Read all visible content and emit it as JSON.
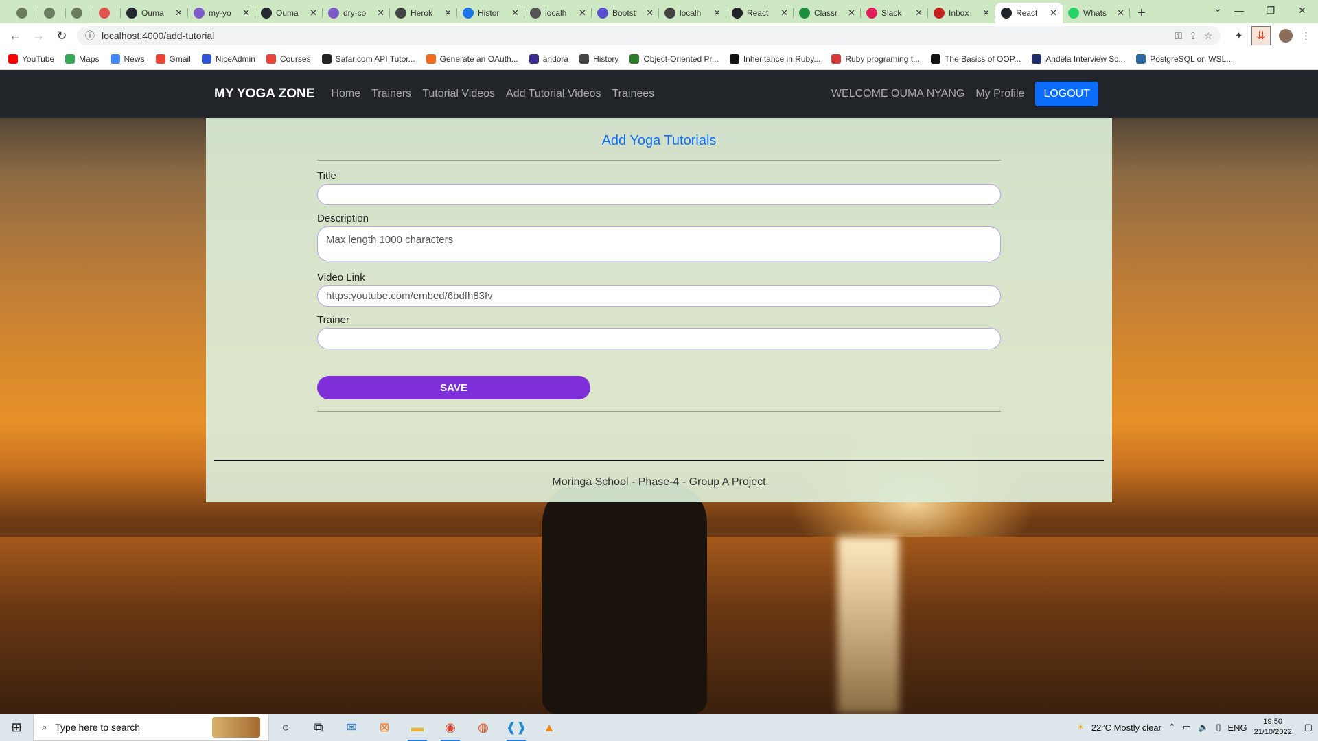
{
  "browser": {
    "tabs": [
      {
        "title": "",
        "fav_color": "#6b7d5e",
        "icon": "hamster-icon",
        "small": true
      },
      {
        "title": "",
        "fav_color": "#6b7d5e",
        "icon": "doc-icon",
        "small": true
      },
      {
        "title": "",
        "fav_color": "#6b7d5e",
        "icon": "hamster-icon",
        "small": true
      },
      {
        "title": "",
        "fav_color": "#e0524a",
        "icon": "ring-icon",
        "small": true
      },
      {
        "title": "Ouma",
        "fav_color": "#24292f",
        "icon": "github-icon"
      },
      {
        "title": "my-yo",
        "fav_color": "#7d5cc9",
        "icon": "heroku-icon"
      },
      {
        "title": "Ouma",
        "fav_color": "#24292f",
        "icon": "github-icon"
      },
      {
        "title": "dry-co",
        "fav_color": "#7d5cc9",
        "icon": "heroku-icon"
      },
      {
        "title": "Herok",
        "fav_color": "#444444",
        "icon": "globe-icon"
      },
      {
        "title": "Histor",
        "fav_color": "#1a73e8",
        "icon": "history-icon"
      },
      {
        "title": "localh",
        "fav_color": "#555555",
        "icon": "react-icon"
      },
      {
        "title": "Bootst",
        "fav_color": "#5a4fcf",
        "icon": "bootstrap-icon"
      },
      {
        "title": "localh",
        "fav_color": "#444444",
        "icon": "globe-icon"
      },
      {
        "title": "React",
        "fav_color": "#20232a",
        "icon": "react-icon"
      },
      {
        "title": "Classr",
        "fav_color": "#1e8e3e",
        "icon": "drive-icon"
      },
      {
        "title": "Slack",
        "fav_color": "#e01e5a",
        "icon": "slack-icon"
      },
      {
        "title": "Inbox",
        "fav_color": "#c5221f",
        "icon": "gmail-icon"
      },
      {
        "title": "React",
        "fav_color": "#20232a",
        "icon": "react-icon",
        "active": true
      },
      {
        "title": "Whats",
        "fav_color": "#25d366",
        "icon": "whatsapp-icon"
      }
    ],
    "url": "localhost:4000/add-tutorial",
    "bookmarks": [
      {
        "label": "YouTube",
        "color": "#ff0000"
      },
      {
        "label": "Maps",
        "color": "#34a853"
      },
      {
        "label": "News",
        "color": "#4285f4"
      },
      {
        "label": "Gmail",
        "color": "#ea4335"
      },
      {
        "label": "NiceAdmin",
        "color": "#2f55d4"
      },
      {
        "label": "Courses",
        "color": "#e8453c"
      },
      {
        "label": "Safaricom API Tutor...",
        "color": "#222222"
      },
      {
        "label": "Generate an OAuth...",
        "color": "#f26b1d"
      },
      {
        "label": "andora",
        "color": "#3b2d8f"
      },
      {
        "label": "History",
        "color": "#444444"
      },
      {
        "label": "Object-Oriented Pr...",
        "color": "#2a7a2a"
      },
      {
        "label": "Inheritance in Ruby...",
        "color": "#111111"
      },
      {
        "label": "Ruby programing t...",
        "color": "#d23c3c"
      },
      {
        "label": "The Basics of OOP...",
        "color": "#111111"
      },
      {
        "label": "Andela Interview Sc...",
        "color": "#1f2d6b"
      },
      {
        "label": "PostgreSQL on WSL...",
        "color": "#2d6aa4"
      }
    ]
  },
  "app": {
    "brand": "MY YOGA ZONE",
    "nav": [
      "Home",
      "Trainers",
      "Tutorial Videos",
      "Add Tutorial Videos",
      "Trainees"
    ],
    "welcome": "WELCOME OUMA NYANG",
    "profile": "My Profile",
    "logout": "LOGOUT",
    "accent": "#0d6efd"
  },
  "form": {
    "title": "Add Yoga Tutorials",
    "title_label": "Title",
    "title_value": "",
    "description_label": "Description",
    "description_placeholder": "Max length 1000 characters",
    "video_label": "Video Link",
    "video_placeholder": "https:youtube.com/embed/6bdfh83fv",
    "trainer_label": "Trainer",
    "trainer_value": "",
    "save": "SAVE",
    "save_color": "#7e2fd7"
  },
  "footer": {
    "text": "Moringa School - Phase-4 - Group A Project"
  },
  "taskbar": {
    "search_placeholder": "Type here to search",
    "weather": "22°C  Mostly clear",
    "lang": "ENG",
    "time": "19:50",
    "date": "21/10/2022"
  }
}
